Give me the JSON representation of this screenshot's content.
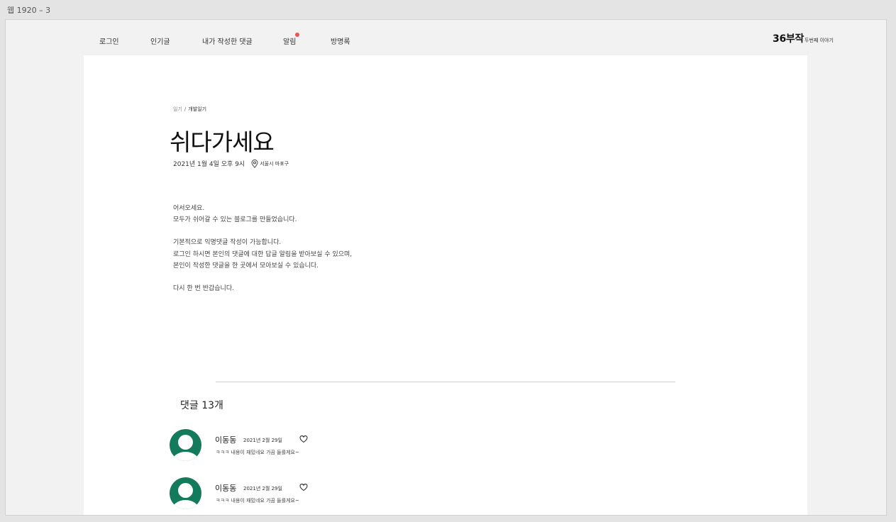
{
  "artboard": {
    "label": "웹 1920 – 3"
  },
  "nav": {
    "items": [
      {
        "label": "로그인"
      },
      {
        "label": "인기글"
      },
      {
        "label": "내가 작성한 댓글"
      },
      {
        "label": "알림",
        "has_notification": true
      },
      {
        "label": "방명록"
      }
    ],
    "brand": {
      "main": "36부작",
      "sub": "두번째 이야기"
    }
  },
  "post": {
    "breadcrumb": {
      "category": "일기",
      "separator": "/",
      "subcategory": "개발일기"
    },
    "title": "쉬다가세요",
    "date": "2021년 1월 4일 오후 9시",
    "location": "서울시 마포구",
    "body": {
      "p1": "어서오세요.",
      "p2": "모두가 쉬어갈 수 있는 블로그를 만들었습니다.",
      "p3": "기본적으로 익명댓글 작성이 가능합니다.",
      "p4": "로그인 하시면 본인의 댓글에 대한 답글 알림을 받아보실 수 있으며,",
      "p5": "본인이 작성한 댓글을 한 곳에서 모아보실 수 있습니다.",
      "p6": "다시 한 번 반갑습니다."
    }
  },
  "comments": {
    "heading": "댓글 13개",
    "items": [
      {
        "author": "이동동",
        "date": "2021년 2월 29일",
        "text": "ㅋㅋㅋ 내용이 재밌네요 가끔 들를게요~"
      },
      {
        "author": "이동동",
        "date": "2021년 2월 29일",
        "text": "ㅋㅋㅋ 내용이 재밌네요 가끔 들를게요~"
      }
    ]
  },
  "colors": {
    "avatar": "#137a5c",
    "notification_dot": "#ef5350",
    "card": "#ffffff",
    "canvas": "#f2f2f2"
  }
}
